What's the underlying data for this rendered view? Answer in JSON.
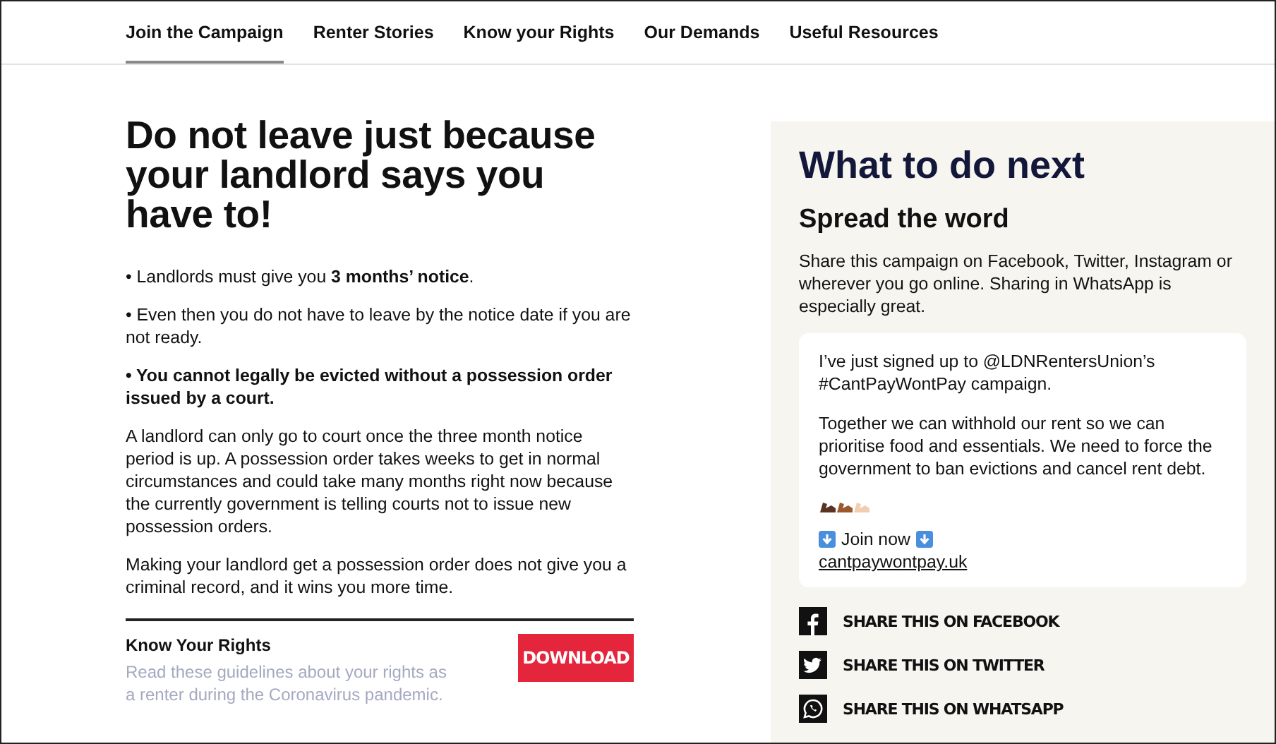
{
  "nav": [
    {
      "label": "Join the Campaign",
      "selected": true
    },
    {
      "label": "Renter Stories",
      "selected": false
    },
    {
      "label": "Know your Rights",
      "selected": false
    },
    {
      "label": "Our Demands",
      "selected": false
    },
    {
      "label": "Useful Resources",
      "selected": false
    }
  ],
  "main": {
    "heading": "Do not leave just because your landlord says you have to!",
    "paragraphs": [
      {
        "text": "• Landlords must give you **3 months’ notice**.",
        "bold": false
      },
      {
        "text": "• Even then you do not have to leave by the notice date if you are not ready.",
        "bold": false
      },
      {
        "text": "• You cannot legally be evicted without a possession order issued by a court.",
        "bold": true
      },
      {
        "text": "A landlord can only go to court once the three month notice period is up. A possession order takes weeks to get in normal circumstances and could take many months right now because the currently government is telling courts not to issue new possession orders.",
        "bold": false
      },
      {
        "text": "Making your landlord get a possession order does not give you a criminal record, and it wins you more time.",
        "bold": false
      }
    ],
    "download": {
      "title": "Know Your Rights",
      "description": "Read these guidelines about your rights as a renter during the Coronavirus pandemic.",
      "button": "DOWNLOAD"
    }
  },
  "aside": {
    "heading": "What to do next",
    "subheading": "Spread the word",
    "intro": "Share this campaign on Facebook, Twitter, Instagram or wherever you go online. Sharing in WhatsApp is especially great.",
    "message": {
      "paragraphs": [
        "I’ve just signed up to @LDNRentersUnion’s #CantPayWontPay campaign.",
        "Together we can withhold our rent so we can prioritise food and essentials. We need to force the government to ban evictions and cancel rent debt."
      ],
      "join": "Join now",
      "link": "cantpaywontpay.uk"
    },
    "share": [
      {
        "kind": "facebook",
        "label": "SHARE THIS ON FACEBOOK"
      },
      {
        "kind": "twitter",
        "label": "SHARE THIS ON TWITTER"
      },
      {
        "kind": "whatsapp",
        "label": "SHARE THIS ON WHATSAPP"
      }
    ]
  }
}
